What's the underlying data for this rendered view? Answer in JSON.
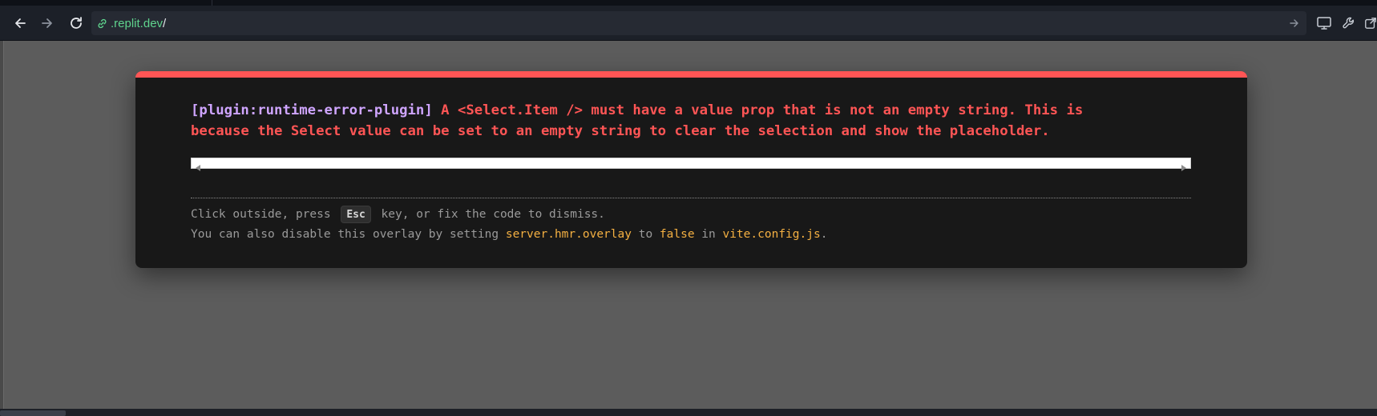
{
  "browser": {
    "url_host": ".replit.dev",
    "url_path": "/"
  },
  "overlay": {
    "plugin": "[plugin:runtime-error-plugin]",
    "message_line1": "A <Select.Item /> must have a value prop that is not an empty string. This is",
    "message_line2": "because the Select value can be set to an empty string to clear the selection and show the placeholder.",
    "tip1_before": "Click outside, press ",
    "tip1_key": "Esc",
    "tip1_after": " key, or fix the code to dismiss.",
    "tip2_before": "You can also disable this overlay by setting ",
    "tip2_code1": "server.hmr.overlay",
    "tip2_mid1": " to ",
    "tip2_code2": "false",
    "tip2_mid2": " in ",
    "tip2_code3": "vite.config.js",
    "tip2_end": "."
  },
  "colors": {
    "accent_red": "#ff5555",
    "plugin_purple": "#cfa5ff",
    "code_yellow": "#f4b042",
    "url_green": "#5fd38d"
  },
  "icons": [
    "back-arrow-icon",
    "forward-arrow-icon",
    "reload-icon",
    "link-icon",
    "go-arrow-icon",
    "monitor-icon",
    "wrench-icon",
    "new-window-icon"
  ]
}
